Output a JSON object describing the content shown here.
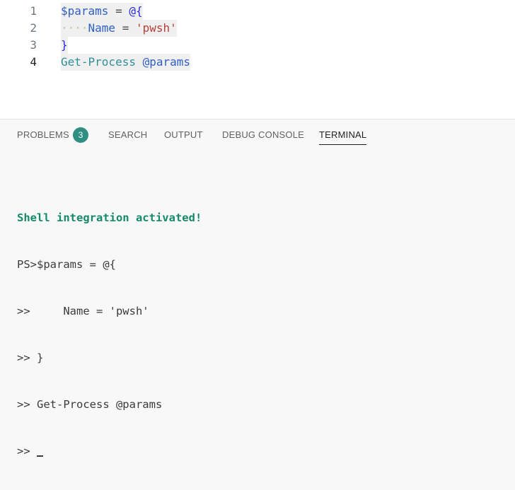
{
  "editor": {
    "lines": [
      {
        "number": "1",
        "t1": "$params",
        "t2": " = ",
        "t3": "@{"
      },
      {
        "number": "2",
        "indent": "····",
        "t1": "Name",
        "t2": " = ",
        "t3": "'pwsh'"
      },
      {
        "number": "3",
        "t1": "}"
      },
      {
        "number": "4",
        "t1": "Get-Process",
        "t2": " ",
        "t3": "@params"
      }
    ]
  },
  "panel": {
    "tabs": [
      {
        "label": "PROBLEMS"
      },
      {
        "label": "SEARCH"
      },
      {
        "label": "OUTPUT"
      },
      {
        "label": "DEBUG CONSOLE"
      },
      {
        "label": "TERMINAL"
      }
    ],
    "problems_count": "3",
    "active_tab": "TERMINAL"
  },
  "terminal": {
    "lines": [
      "Shell integration activated!",
      "PS>$params = @{",
      ">>     Name = 'pwsh'",
      ">> }",
      ">> Get-Process @params",
      ">> "
    ]
  },
  "colors": {
    "badge": "#2f8f83",
    "success_text": "#148a6b",
    "variable": "#2f5ec4",
    "string": "#b3403a",
    "command": "#2f8f9a"
  }
}
